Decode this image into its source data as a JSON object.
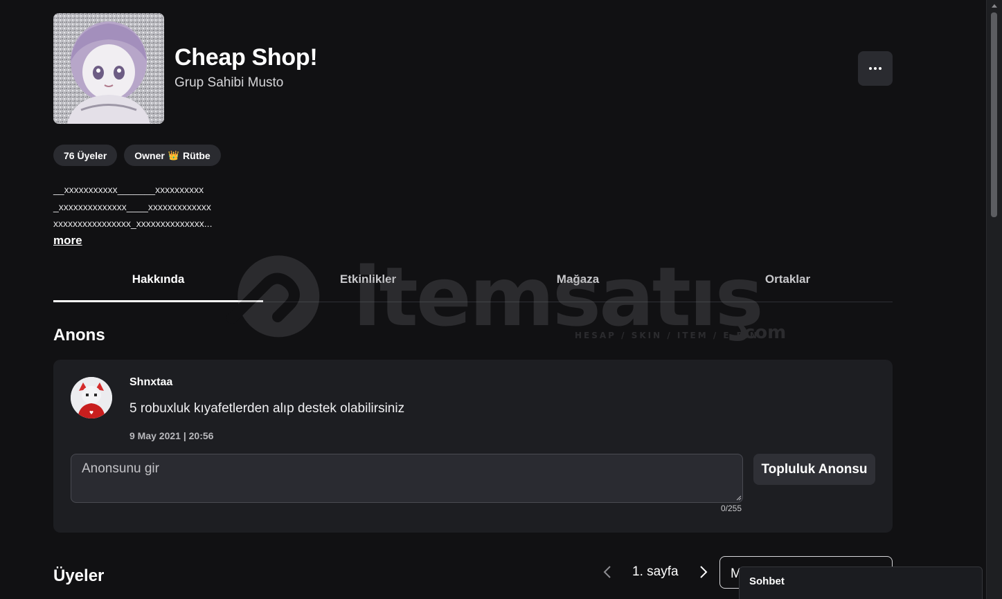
{
  "group": {
    "name": "Cheap Shop!",
    "owner_line": "Grup Sahibi Musto",
    "members_pill": "76 Üyeler",
    "rank_owner": "Owner",
    "rank_crown": "👑",
    "rank_label": "Rütbe",
    "description_lines": [
      "__xxxxxxxxxxx_______xxxxxxxxxx",
      "_xxxxxxxxxxxxxx____xxxxxxxxxxxxx",
      "xxxxxxxxxxxxxxxx_xxxxxxxxxxxxxx..."
    ],
    "more_label": "more"
  },
  "tabs": [
    {
      "label": "Hakkında",
      "active": true
    },
    {
      "label": "Etkinlikler",
      "active": false
    },
    {
      "label": "Mağaza",
      "active": false
    },
    {
      "label": "Ortaklar",
      "active": false
    }
  ],
  "watermark": {
    "brand": "itemsatış",
    "tagline": "HESAP / SKIN / ITEM / E-PIN",
    "suffix": ".com"
  },
  "announcement": {
    "section_title": "Anons",
    "poster": "Shnxtaa",
    "text": "5 robuxluk kıyafetlerden alıp destek olabilirsiniz",
    "date": "9 May 2021 | 20:56",
    "input_placeholder": "Anonsunu gir",
    "char_count": "0/255",
    "post_button": "Topluluk Anonsu"
  },
  "members": {
    "section_title": "Üyeler",
    "page_label": "1. sayfa",
    "role_select_value": "M"
  },
  "chat": {
    "label": "Sohbet"
  },
  "colors": {
    "background": "#111113",
    "card": "#1d1e22",
    "pill": "#2a2b30",
    "text": "#ffffff"
  }
}
